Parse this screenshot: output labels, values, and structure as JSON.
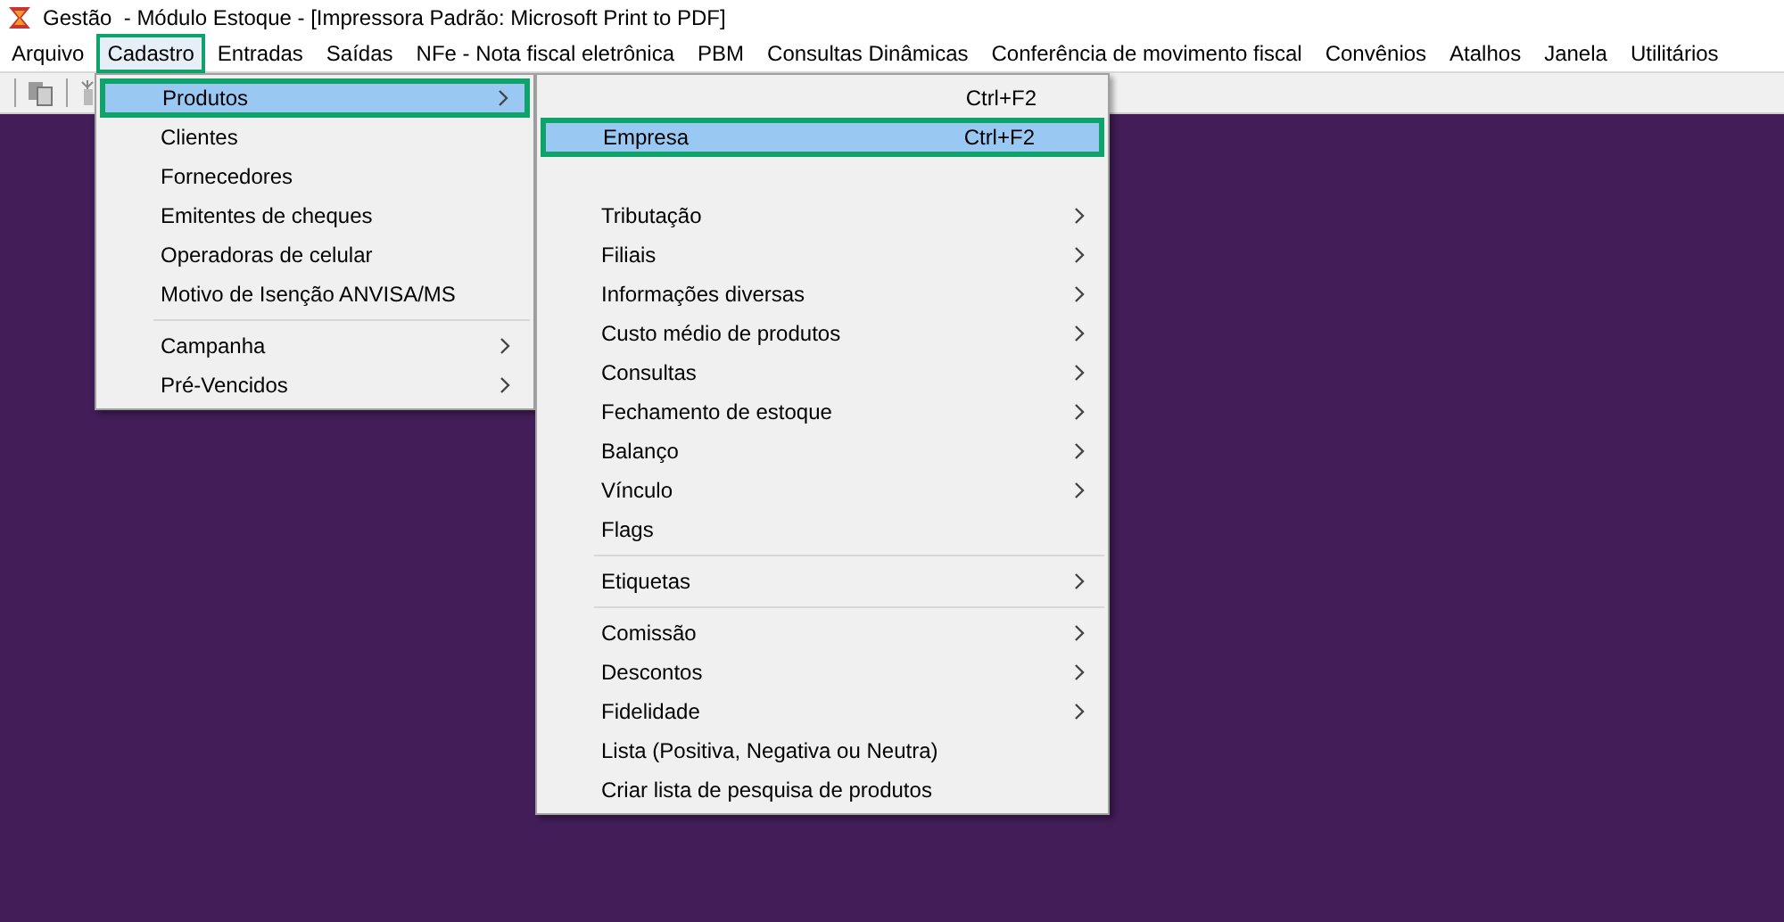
{
  "window": {
    "title": "Gestão  - Módulo Estoque - [Impressora Padrão: Microsoft Print to PDF]"
  },
  "menu_bar": [
    {
      "label": "Arquivo",
      "selected": false
    },
    {
      "label": "Cadastro",
      "selected": true
    },
    {
      "label": "Entradas",
      "selected": false
    },
    {
      "label": "Saídas",
      "selected": false
    },
    {
      "label": "NFe - Nota fiscal eletrônica",
      "selected": false
    },
    {
      "label": "PBM",
      "selected": false
    },
    {
      "label": "Consultas Dinâmicas",
      "selected": false
    },
    {
      "label": "Conferência de movimento fiscal",
      "selected": false
    },
    {
      "label": "Convênios",
      "selected": false
    },
    {
      "label": "Atalhos",
      "selected": false
    },
    {
      "label": "Janela",
      "selected": false
    },
    {
      "label": "Utilitários",
      "selected": false
    }
  ],
  "cadastro_menu": [
    {
      "kind": "item",
      "label": "Produtos",
      "submenu": true,
      "selected": true
    },
    {
      "kind": "item",
      "label": "Clientes",
      "submenu": false,
      "selected": false
    },
    {
      "kind": "item",
      "label": "Fornecedores",
      "submenu": false,
      "selected": false
    },
    {
      "kind": "item",
      "label": "Emitentes de cheques",
      "submenu": false,
      "selected": false
    },
    {
      "kind": "item",
      "label": "Operadoras de celular",
      "submenu": false,
      "selected": false
    },
    {
      "kind": "item",
      "label": "Motivo de Isenção ANVISA/MS",
      "submenu": false,
      "selected": false
    },
    {
      "kind": "separator"
    },
    {
      "kind": "item",
      "label": "Campanha",
      "submenu": true,
      "selected": false
    },
    {
      "kind": "item",
      "label": "Pré-Vencidos",
      "submenu": true,
      "selected": false
    }
  ],
  "produtos_menu": [
    {
      "kind": "item",
      "shortcut": "Ctrl+F2",
      "submenu": false,
      "selected": false
    },
    {
      "kind": "item",
      "label": "Empresa",
      "shortcut": "Ctrl+F2",
      "submenu": false,
      "selected": true
    },
    {
      "kind": "obscured"
    },
    {
      "kind": "item",
      "label": "Tributação",
      "submenu": true,
      "selected": false
    },
    {
      "kind": "item",
      "label": "Filiais",
      "submenu": true,
      "selected": false
    },
    {
      "kind": "item",
      "label": "Informações diversas",
      "submenu": true,
      "selected": false
    },
    {
      "kind": "item",
      "label": "Custo médio de produtos",
      "submenu": true,
      "selected": false
    },
    {
      "kind": "item",
      "label": "Consultas",
      "submenu": true,
      "selected": false
    },
    {
      "kind": "item",
      "label": "Fechamento de estoque",
      "submenu": true,
      "selected": false
    },
    {
      "kind": "item",
      "label": "Balanço",
      "submenu": true,
      "selected": false
    },
    {
      "kind": "item",
      "label": "Vínculo",
      "submenu": true,
      "selected": false
    },
    {
      "kind": "item",
      "label": "Flags",
      "submenu": false,
      "selected": false
    },
    {
      "kind": "separator"
    },
    {
      "kind": "item",
      "label": "Etiquetas",
      "submenu": true,
      "selected": false
    },
    {
      "kind": "separator"
    },
    {
      "kind": "item",
      "label": "Comissão",
      "submenu": true,
      "selected": false
    },
    {
      "kind": "item",
      "label": "Descontos",
      "submenu": true,
      "selected": false
    },
    {
      "kind": "item",
      "label": "Fidelidade",
      "submenu": true,
      "selected": false
    },
    {
      "kind": "item",
      "label": "Lista (Positiva, Negativa ou Neutra)",
      "submenu": false,
      "selected": false
    },
    {
      "kind": "item",
      "label": "Criar lista de pesquisa de produtos",
      "submenu": false,
      "selected": false
    }
  ]
}
